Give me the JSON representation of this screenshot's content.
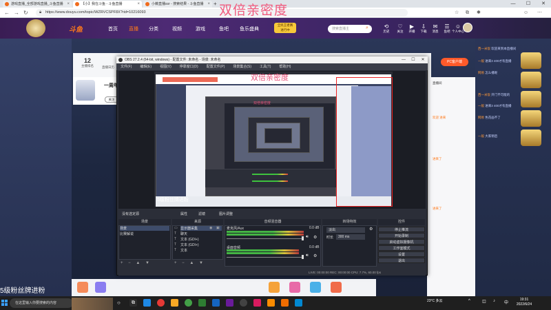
{
  "browser": {
    "tabs": [
      {
        "label": "游戏直播_全部游戏直播_斗鱼直播"
      },
      {
        "label": "【小】我在斗鱼 - 斗鱼直播"
      },
      {
        "label": "小薇直播ssr - 搜索结果 - 斗鱼直播"
      },
      {
        "label": "我的资料 - 个人中心 - 斗鱼"
      }
    ],
    "new_tab": "+",
    "url": "https://www.douyu.com/topic/WZRVCSPF8X?rid=10216093",
    "window_controls": [
      "—",
      "☐",
      "✕"
    ]
  },
  "watermark": "双倍亲密度",
  "douyu": {
    "logo": "斗鱼",
    "nav": [
      "首页",
      "直播",
      "分类",
      "视频",
      "游戏",
      "鱼吧",
      "鱼乐盛典"
    ],
    "badge": [
      "全民王者赛",
      "进行中"
    ],
    "search_placeholder": "搜索直播主",
    "header_icons": [
      {
        "label": "历史",
        "glyph": "⟲"
      },
      {
        "label": "关注",
        "glyph": "♡"
      },
      {
        "label": "开播",
        "glyph": "▶"
      },
      {
        "label": "下载",
        "glyph": "⇩"
      },
      {
        "label": "消息",
        "glyph": "✉"
      },
      {
        "label": "鱼吧",
        "glyph": "☰"
      },
      {
        "label": "个人中心",
        "glyph": "☺"
      }
    ],
    "rank_number": "12",
    "rank_label": "主播排名",
    "rank_label2": "直播日历",
    "room_title": "一周年",
    "follow_btn": "关注",
    "pc_button": "PC客户端",
    "fan_text": "5级粉丝牌进粉",
    "chat_lines": [
      "直播间 ",
      "欢迎 进来",
      "进来了",
      "进来了"
    ],
    "right_messages": [
      {
        "user": "西一米饭",
        "text": " 欢迎来到本直播间"
      },
      {
        "user": "一般",
        "text": " 进来3 400才有直播"
      },
      {
        "user": "网易",
        "text": " 怎么播呢"
      },
      {
        "user": "西一米饭",
        "text": " 开门不可能的"
      },
      {
        "user": "一般",
        "text": " 进来3 400才有直播"
      },
      {
        "user": "网易",
        "text": " 色花画不了"
      },
      {
        "user": "一般",
        "text": " 大家稍后"
      }
    ]
  },
  "obs": {
    "title": "OBS 27.2.4 (64-bit, windows) - 配置文件: 未命名 - 场景: 未命名",
    "menu": [
      "文件(F)",
      "编辑(E)",
      "视图(V)",
      "停靠窗口(D)",
      "配置文件(P)",
      "场景集合(S)",
      "工具(T)",
      "帮助(H)"
    ],
    "inner_watermark": "双倍亲密度",
    "inner_fan_text": "5级粉丝牌进粉",
    "tabs": [
      "没有选定源",
      "属性",
      "滤镜",
      "图片调整"
    ],
    "docks": {
      "scenes": {
        "title": "场景",
        "items": [
          "场景",
          "比赛解说"
        ]
      },
      "sources": {
        "title": "来源",
        "items": [
          "显示器采集",
          "聊天",
          "文本 (GDI+)",
          "文本 (GDI+)",
          "文本"
        ]
      },
      "mixer": {
        "title": "音频混音器",
        "channels": [
          {
            "name": "麦克风/Aux",
            "db": "0.0 dB"
          },
          {
            "name": "桌面音频",
            "db": "0.0 dB"
          }
        ]
      },
      "transitions": {
        "title": "转场特效",
        "type": "淡出",
        "duration_label": "时长",
        "duration": "300 ms"
      },
      "controls": {
        "title": "控件",
        "buttons": [
          "停止推流",
          "开始录制",
          "启动虚拟摄像机",
          "工作室模式",
          "设置",
          "退出"
        ]
      }
    },
    "dock_toolbar": "+ − ▲ ▼",
    "status": "LIVE: 00:00:00   REC: 00:00:00   CPU: 7.7%, 60.00 fps"
  },
  "taskbar": {
    "search_placeholder": "在这里输入你要搜索的内容",
    "weather": "23°C 多云",
    "time": "19:31",
    "date": "2022/6/24"
  },
  "colors": {
    "accent": "#ff7a1a",
    "watermark": "#f05a7e",
    "obs_bg": "#2b2e38"
  }
}
